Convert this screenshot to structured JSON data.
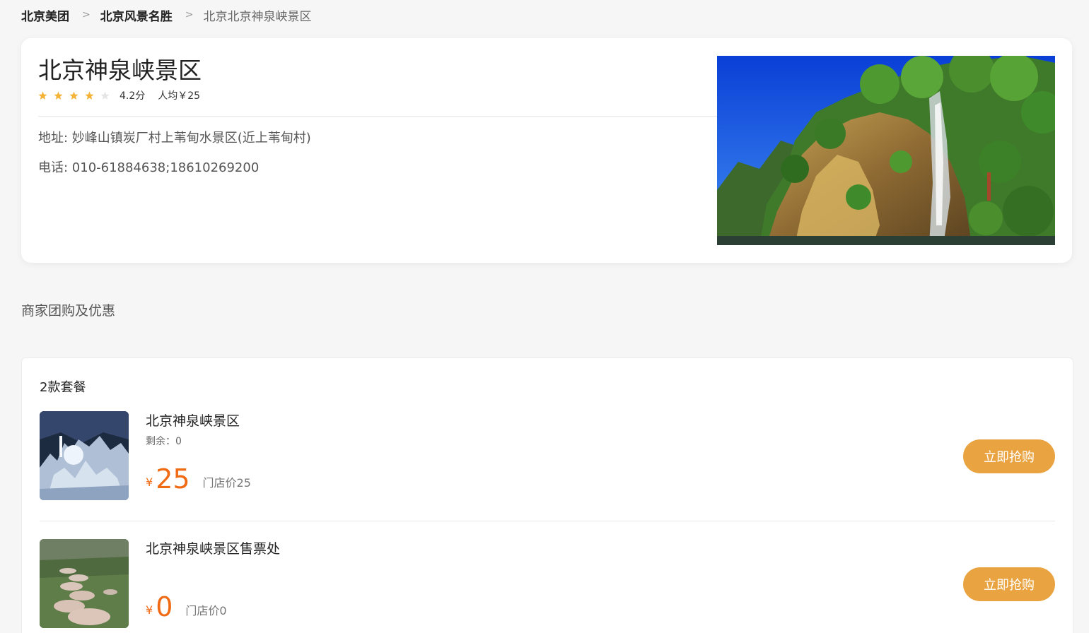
{
  "breadcrumb": {
    "items": [
      "北京美团",
      "北京风景名胜"
    ],
    "current": "北京北京神泉峡景区",
    "separator": ">"
  },
  "poi": {
    "title": "北京神泉峡景区",
    "rating": 4.2,
    "rating_text": "4.2分",
    "avg_price": "人均￥25",
    "address": "地址: 妙峰山镇炭厂村上苇甸水景区(近上苇甸村)",
    "phone": "电话: 010-61884638;18610269200"
  },
  "section_title": "商家团购及优惠",
  "deals": {
    "count_label": "2款套餐",
    "items": [
      {
        "name": "北京神泉峡景区",
        "stock": "剩余：0",
        "currency": "¥",
        "price": "25",
        "store_price": "门店价25",
        "button": "立即抢购"
      },
      {
        "name": "北京神泉峡景区售票处",
        "stock": "",
        "currency": "¥",
        "price": "0",
        "store_price": "门店价0",
        "button": "立即抢购"
      }
    ]
  },
  "colors": {
    "accent_orange": "#f06a14",
    "button": "#e9a441",
    "star_on": "#f5b335",
    "star_off": "#e5e5e5"
  },
  "icons": {
    "star": "star-icon"
  }
}
